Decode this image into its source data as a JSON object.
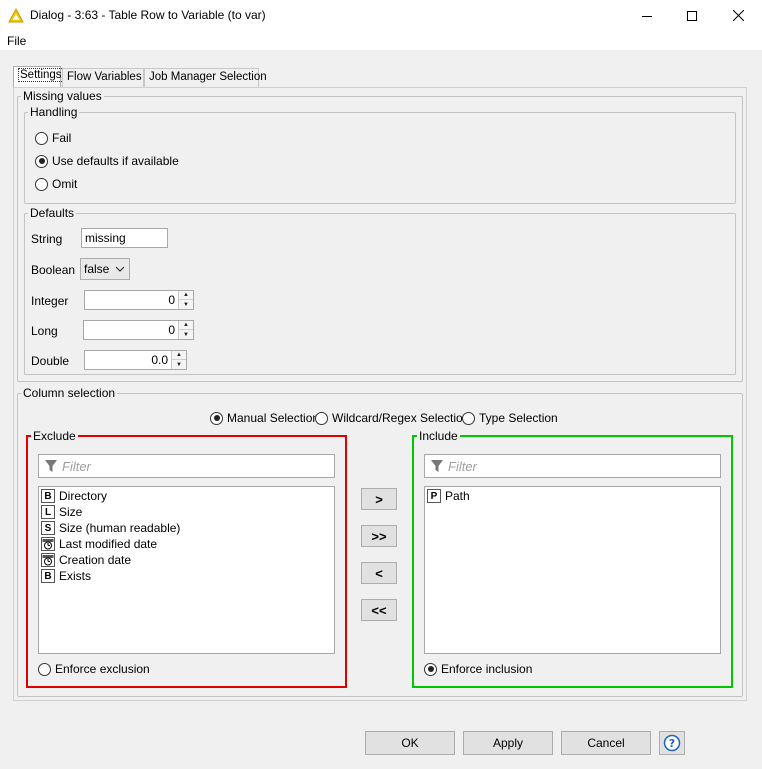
{
  "window": {
    "title": "Dialog - 3:63 - Table Row to Variable (to var)"
  },
  "menu": {
    "file": "File"
  },
  "tabs": [
    {
      "label": "Settings",
      "active": true
    },
    {
      "label": "Flow Variables",
      "active": false
    },
    {
      "label": "Job Manager Selection",
      "active": false
    }
  ],
  "missing_values": {
    "legend": "Missing values",
    "handling": {
      "legend": "Handling",
      "options": [
        {
          "label": "Fail",
          "selected": false
        },
        {
          "label": "Use defaults if available",
          "selected": true
        },
        {
          "label": "Omit",
          "selected": false
        }
      ]
    },
    "defaults": {
      "legend": "Defaults",
      "string": {
        "label": "String",
        "value": "missing"
      },
      "boolean": {
        "label": "Boolean",
        "value": "false"
      },
      "integer": {
        "label": "Integer",
        "value": "0"
      },
      "long": {
        "label": "Long",
        "value": "0"
      },
      "double": {
        "label": "Double",
        "value": "0.0"
      }
    }
  },
  "column_selection": {
    "legend": "Column selection",
    "modes": [
      {
        "label": "Manual Selection",
        "selected": true
      },
      {
        "label": "Wildcard/Regex Selection",
        "selected": false
      },
      {
        "label": "Type Selection",
        "selected": false
      }
    ],
    "exclude": {
      "legend": "Exclude",
      "filter_placeholder": "Filter",
      "items": [
        {
          "type": "B",
          "label": "Directory"
        },
        {
          "type": "L",
          "label": "Size"
        },
        {
          "type": "S",
          "label": "Size (human readable)"
        },
        {
          "type": "date-time",
          "label": "Last modified date"
        },
        {
          "type": "date-time",
          "label": "Creation date"
        },
        {
          "type": "B",
          "label": "Exists"
        }
      ],
      "enforce": {
        "label": "Enforce exclusion",
        "selected": false
      }
    },
    "include": {
      "legend": "Include",
      "filter_placeholder": "Filter",
      "items": [
        {
          "type": "P",
          "label": "Path"
        }
      ],
      "enforce": {
        "label": "Enforce inclusion",
        "selected": true
      }
    },
    "move_buttons": {
      "add": ">",
      "add_all": ">>",
      "remove": "<",
      "remove_all": "<<"
    },
    "colors": {
      "exclude_border": "#e00000",
      "include_border": "#00c800"
    }
  },
  "buttons": {
    "ok": "OK",
    "apply": "Apply",
    "cancel": "Cancel",
    "help_icon": "help-icon"
  }
}
